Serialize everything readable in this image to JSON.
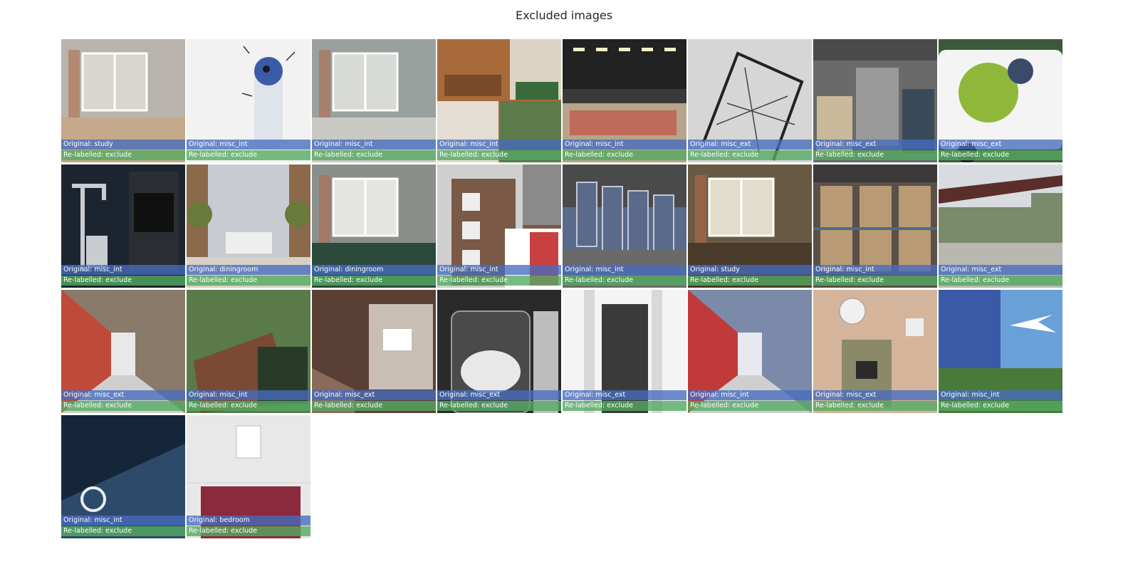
{
  "title": "Excluded images",
  "tiles": [
    {
      "original": "Original: study",
      "relabelled": "Re-labelled: exclude",
      "scene": "interior-window",
      "colors": [
        "#b8b4ad",
        "#d9d6d0",
        "#c4a98a"
      ]
    },
    {
      "original": "Original: misc_int",
      "relabelled": "Re-labelled: exclude",
      "scene": "robot-wall",
      "colors": [
        "#f2f2f2",
        "#e6e6e6",
        "#3b5aa8"
      ]
    },
    {
      "original": "Original: misc_int",
      "relabelled": "Re-labelled: exclude",
      "scene": "interior-window",
      "colors": [
        "#9aa09e",
        "#d8dad6",
        "#c9c9c4"
      ]
    },
    {
      "original": "Original: misc_int",
      "relabelled": "Re-labelled: exclude",
      "scene": "collage",
      "colors": [
        "#a86a3a",
        "#e3ddd4",
        "#5d7a4a"
      ]
    },
    {
      "original": "Original: misc_int",
      "relabelled": "Re-labelled: exclude",
      "scene": "shop-counter",
      "colors": [
        "#3a3a3a",
        "#6e5a44",
        "#b8a48a"
      ]
    },
    {
      "original": "Original: misc_ext",
      "relabelled": "Re-labelled: exclude",
      "scene": "sketch",
      "colors": [
        "#9c9c9c",
        "#d6d6d6",
        "#3a3a3a"
      ]
    },
    {
      "original": "Original: misc_ext",
      "relabelled": "Re-labelled: exclude",
      "scene": "garage",
      "colors": [
        "#6a6a6a",
        "#c9b89a",
        "#3a4a5a"
      ]
    },
    {
      "original": "Original: misc_ext",
      "relabelled": "Re-labelled: exclude",
      "scene": "van",
      "colors": [
        "#f4f4f4",
        "#8fb83a",
        "#3c5a3a"
      ]
    },
    {
      "original": "Original: misc_int",
      "relabelled": "Re-labelled: exclude",
      "scene": "appliances",
      "colors": [
        "#1c2430",
        "#c9ccd0",
        "#2a2e33"
      ]
    },
    {
      "original": "Original: diningroom",
      "relabelled": "Re-labelled: exclude",
      "scene": "interior-door",
      "colors": [
        "#c9cbd2",
        "#eeeeee",
        "#8a6a4a"
      ]
    },
    {
      "original": "Original: diningroom",
      "relabelled": "Re-labelled: exclude",
      "scene": "interior-window",
      "colors": [
        "#8a8f8c",
        "#e4e4e0",
        "#2c4a3c"
      ]
    },
    {
      "original": "Original: misc_int",
      "relabelled": "Re-labelled: exclude",
      "scene": "house-collage",
      "colors": [
        "#7a5a46",
        "#cfcfcf",
        "#c94040"
      ]
    },
    {
      "original": "Original: misc_int",
      "relabelled": "Re-labelled: exclude",
      "scene": "model",
      "colors": [
        "#5a6a8a",
        "#c4c8d8",
        "#4a4a4a"
      ]
    },
    {
      "original": "Original: study",
      "relabelled": "Re-labelled: exclude",
      "scene": "interior-window",
      "colors": [
        "#6a5a44",
        "#e2dccc",
        "#4a3a2a"
      ]
    },
    {
      "original": "Original: misc_int",
      "relabelled": "Re-labelled: exclude",
      "scene": "warehouse",
      "colors": [
        "#5a5048",
        "#b89a74",
        "#4a6a8a"
      ]
    },
    {
      "original": "Original: misc_ext",
      "relabelled": "Re-labelled: exclude",
      "scene": "canopy",
      "colors": [
        "#7a8a6a",
        "#b8b8b0",
        "#5a2e2a"
      ]
    },
    {
      "original": "Original: misc_ext",
      "relabelled": "Re-labelled: exclude",
      "scene": "store-aisle",
      "colors": [
        "#8a7a6a",
        "#e8e8e8",
        "#c04a3a"
      ]
    },
    {
      "original": "Original: misc_int",
      "relabelled": "Re-labelled: exclude",
      "scene": "sign",
      "colors": [
        "#5a7a4a",
        "#7a4a34",
        "#2a3a2a"
      ]
    },
    {
      "original": "Original: misc_ext",
      "relabelled": "Re-labelled: exclude",
      "scene": "empty-room",
      "colors": [
        "#5a4034",
        "#c8beb4",
        "#8a6a5a"
      ]
    },
    {
      "original": "Original: misc_ext",
      "relabelled": "Re-labelled: exclude",
      "scene": "jar",
      "colors": [
        "#2a2a2a",
        "#e8e8e8",
        "#bdbdbd"
      ]
    },
    {
      "original": "Original: misc_ext",
      "relabelled": "Re-labelled: exclude",
      "scene": "doorway",
      "colors": [
        "#d8d8d8",
        "#3a3a3a",
        "#f4f4f4"
      ]
    },
    {
      "original": "Original: misc_int",
      "relabelled": "Re-labelled: exclude",
      "scene": "store-aisle",
      "colors": [
        "#7a8aa8",
        "#e8e8f0",
        "#c03a3a"
      ]
    },
    {
      "original": "Original: misc_ext",
      "relabelled": "Re-labelled: exclude",
      "scene": "wall-device",
      "colors": [
        "#d4b49a",
        "#8a8a6a",
        "#eeeeee"
      ]
    },
    {
      "original": "Original: misc_int",
      "relabelled": "Re-labelled: exclude",
      "scene": "poster",
      "colors": [
        "#3a5aa8",
        "#6aa0d8",
        "#4a7a3a"
      ]
    },
    {
      "original": "Original: misc_int",
      "relabelled": "Re-labelled: exclude",
      "scene": "bosch",
      "colors": [
        "#16263a",
        "#2e4a6a",
        "#e8eef4"
      ]
    },
    {
      "original": "Original: bedroom",
      "relabelled": "Re-labelled: exclude",
      "scene": "bedroom",
      "colors": [
        "#e8e8e8",
        "#cfcfcf",
        "#8a2a3a"
      ]
    }
  ]
}
